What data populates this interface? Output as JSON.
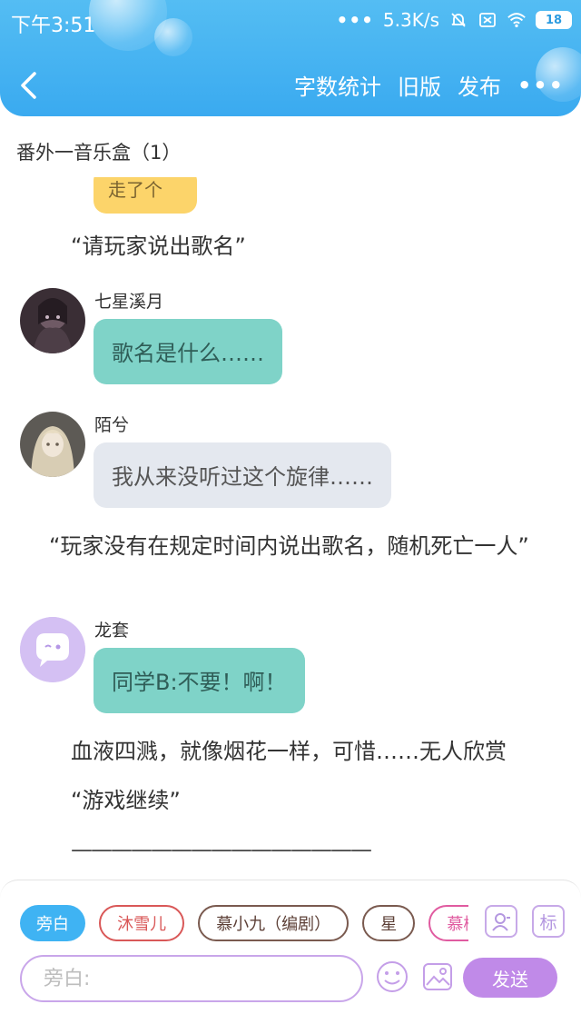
{
  "status": {
    "time": "下午3:51",
    "dots": "•••",
    "speed": "5.3K/s",
    "battery": "18"
  },
  "nav": {
    "word_count": "字数统计",
    "old_version": "旧版",
    "publish": "发布",
    "more": "•••"
  },
  "chapter_title": "番外一音乐盒（1）",
  "partial_bubble_text": "走了个",
  "content": [
    {
      "type": "narration",
      "text": "“请玩家说出歌名”"
    },
    {
      "type": "message",
      "sender": "七星溪月",
      "text": "歌名是什么……",
      "style": "teal"
    },
    {
      "type": "message",
      "sender": "陌兮",
      "text": "我从来没听过这个旋律……",
      "style": "gray"
    },
    {
      "type": "narration",
      "text": "　“玩家没有在规定时间内说出歌名，随机死亡一人”"
    },
    {
      "type": "message",
      "sender": "龙套",
      "text": "同学B:不要！啊！",
      "style": "teal"
    },
    {
      "type": "narration",
      "text": "血液四溅，就像烟花一样，可惜……无人欣赏"
    },
    {
      "type": "narration",
      "text": "“游戏继续”"
    },
    {
      "type": "narration",
      "text": "———————————————"
    }
  ],
  "bottom": {
    "chips": [
      "旁白",
      "沐雪儿",
      "慕小九（编剧）",
      "星",
      "慕樨"
    ],
    "icon_label": "标",
    "input_placeholder": "旁白:",
    "send_label": "发送"
  },
  "colors": {
    "header": "#3aaaf0",
    "teal_bubble": "#7fd3c8",
    "gray_bubble": "#e4e8ef",
    "accent": "#c08ae8"
  }
}
